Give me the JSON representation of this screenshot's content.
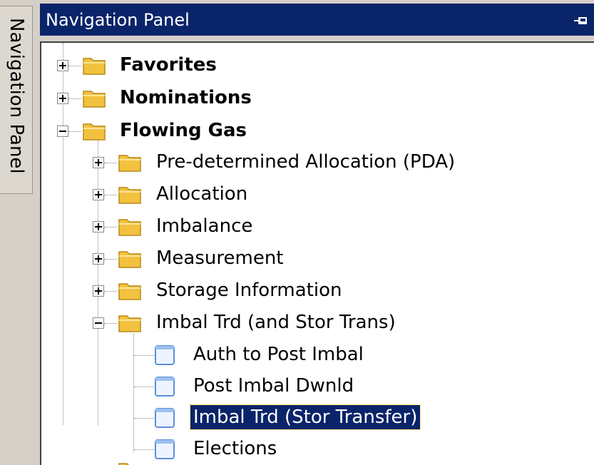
{
  "side_tab": {
    "label": "Navigation Panel"
  },
  "header": {
    "title": "Navigation Panel",
    "pin_icon": "pin-icon"
  },
  "tree": {
    "favorites": "Favorites",
    "nominations": "Nominations",
    "flowing_gas": "Flowing Gas",
    "flowing_children": [
      "Pre-determined Allocation (PDA)",
      "Allocation",
      "Imbalance",
      "Measurement",
      "Storage Information",
      "Imbal Trd (and Stor Trans)"
    ],
    "imbal_children": [
      "Auth to Post Imbal",
      "Post Imbal Dwnld",
      "Imbal Trd (Stor Transfer)",
      "Elections"
    ]
  },
  "colors": {
    "header_bg": "#0a246a",
    "selection_bg": "#0a246a",
    "folder": "#f2c23e"
  }
}
